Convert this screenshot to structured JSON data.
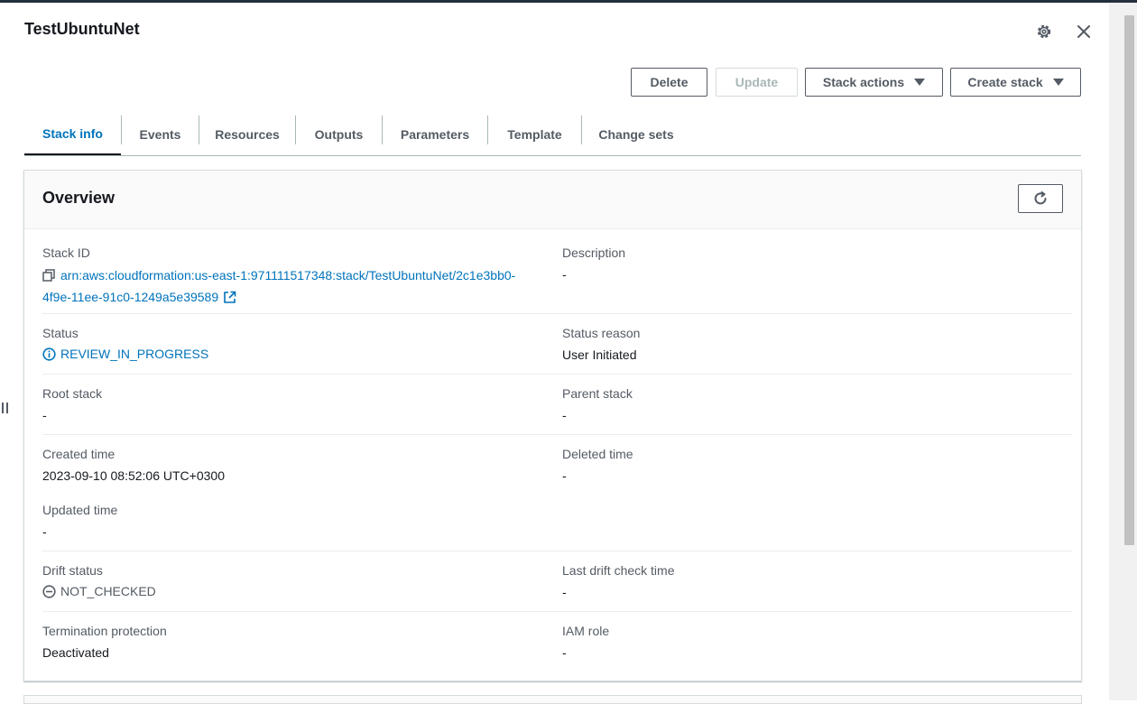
{
  "stack": {
    "name": "TestUbuntuNet"
  },
  "actions": {
    "delete": "Delete",
    "update": "Update",
    "stack_actions": "Stack actions",
    "create_stack": "Create stack"
  },
  "tabs": [
    "Stack info",
    "Events",
    "Resources",
    "Outputs",
    "Parameters",
    "Template",
    "Change sets"
  ],
  "overview": {
    "title": "Overview",
    "stack_id_label": "Stack ID",
    "stack_id_line1": "arn:aws:cloudformation:us-east-1:971111517348:stack/TestUbuntuNet/2c1e3bb0-",
    "stack_id_line2": "4f9e-11ee-91c0-1249a5e39589",
    "description_label": "Description",
    "description_value": "-",
    "status_label": "Status",
    "status_value": "REVIEW_IN_PROGRESS",
    "status_reason_label": "Status reason",
    "status_reason_value": "User Initiated",
    "root_stack_label": "Root stack",
    "root_stack_value": "-",
    "parent_stack_label": "Parent stack",
    "parent_stack_value": "-",
    "created_time_label": "Created time",
    "created_time_value": "2023-09-10 08:52:06 UTC+0300",
    "deleted_time_label": "Deleted time",
    "deleted_time_value": "-",
    "updated_time_label": "Updated time",
    "updated_time_value": "-",
    "drift_status_label": "Drift status",
    "drift_status_value": "NOT_CHECKED",
    "last_drift_label": "Last drift check time",
    "last_drift_value": "-",
    "termination_label": "Termination protection",
    "termination_value": "Deactivated",
    "iam_role_label": "IAM role",
    "iam_role_value": "-"
  },
  "colors": {
    "link": "#0073bb",
    "text": "#16191f",
    "secondary": "#545b64",
    "border": "#d5dbdb"
  },
  "icons": [
    "gear-icon",
    "close-icon",
    "caret-down-icon",
    "refresh-icon",
    "copy-icon",
    "external-link-icon",
    "info-icon",
    "not-checked-icon"
  ]
}
